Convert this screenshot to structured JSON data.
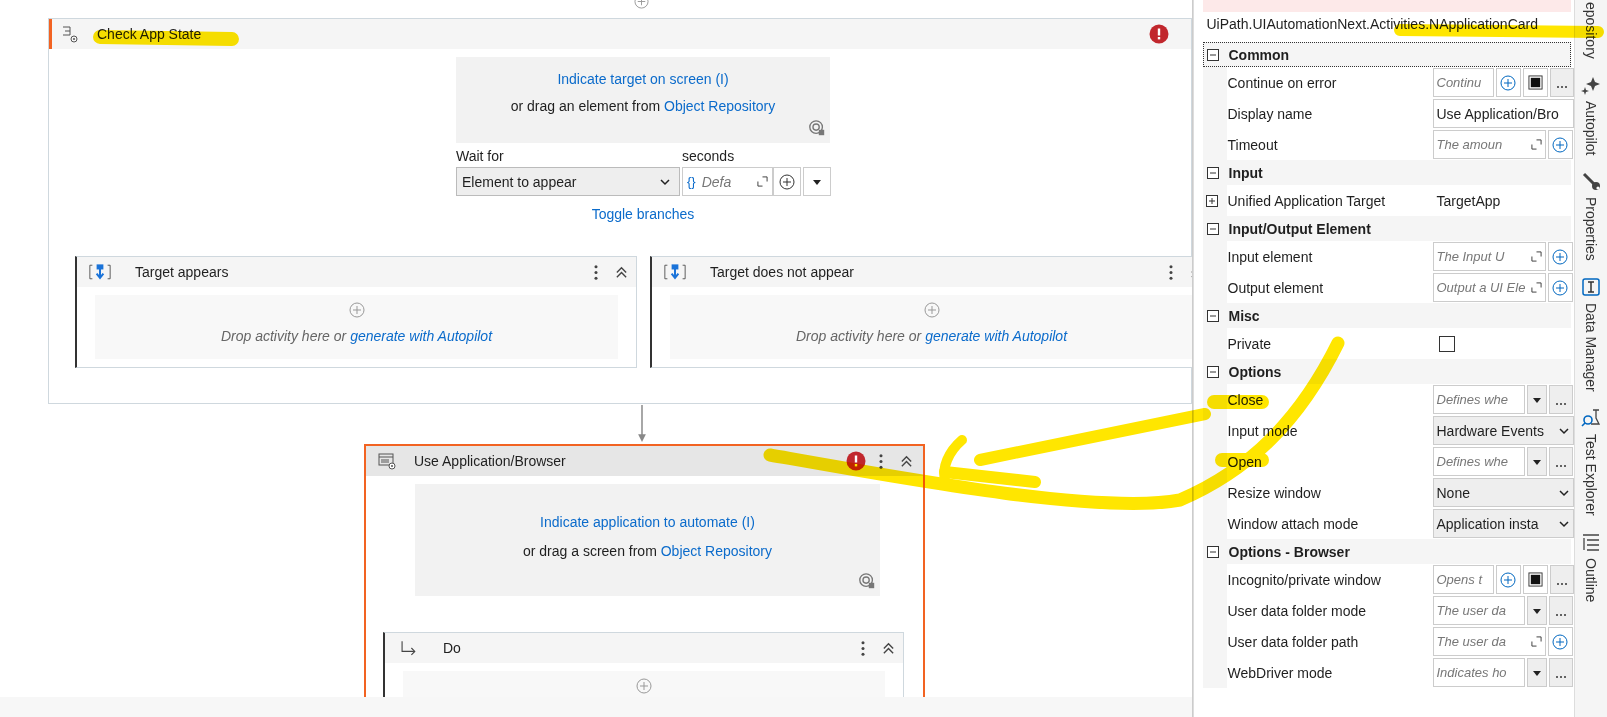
{
  "canvas": {
    "check_card": {
      "title": "Check App State",
      "error": true,
      "target": {
        "link": "Indicate target on screen (I)",
        "prefix": "or drag an element from",
        "repo_link": "Object Repository"
      },
      "wait_for": {
        "label": "Wait for",
        "value": "Element to appear"
      },
      "seconds": {
        "label": "seconds",
        "braces": "{}",
        "placeholder": "Defa"
      },
      "toggle": "Toggle branches",
      "branches": [
        {
          "title": "Target appears",
          "drop_text": "Drop activity here or",
          "drop_link": "generate with Autopilot"
        },
        {
          "title": "Target does not appear",
          "drop_text": "Drop activity here or",
          "drop_link": "generate with Autopilot"
        }
      ]
    },
    "app_card": {
      "title": "Use Application/Browser",
      "error": true,
      "selected": true,
      "target": {
        "link": "Indicate application to automate (I)",
        "prefix": "or drag a screen from",
        "repo_link": "Object Repository"
      },
      "do": {
        "title": "Do"
      }
    }
  },
  "properties": {
    "class_name": "UiPath.UIAutomationNext.Activities.NApplicationCard",
    "sections": [
      {
        "title": "Common",
        "expanded": true,
        "focused": true,
        "rows": [
          {
            "label": "Continue on error",
            "kind": "expr-bool",
            "placeholder": "Continu"
          },
          {
            "label": "Display name",
            "kind": "text",
            "value": "Use Application/Bro"
          },
          {
            "label": "Timeout",
            "kind": "expand",
            "placeholder": "The amoun"
          }
        ]
      },
      {
        "title": "Input",
        "expanded": true,
        "focused": false,
        "rows": [
          {
            "label": "Unified Application Target",
            "kind": "plain",
            "value": "TargetApp",
            "expanded": false
          }
        ]
      },
      {
        "title": "Input/Output Element",
        "expanded": true,
        "focused": false,
        "rows": [
          {
            "label": "Input element",
            "kind": "expand",
            "placeholder": "The Input U"
          },
          {
            "label": "Output element",
            "kind": "expand",
            "placeholder": "Output a UI Ele"
          }
        ]
      },
      {
        "title": "Misc",
        "expanded": true,
        "focused": false,
        "rows": [
          {
            "label": "Private",
            "kind": "checkbox",
            "checked": false
          }
        ]
      },
      {
        "title": "Options",
        "expanded": true,
        "focused": false,
        "rows": [
          {
            "label": "Close",
            "kind": "enum-expr",
            "placeholder": "Defines whe"
          },
          {
            "label": "Input mode",
            "kind": "select",
            "value": "Hardware Events"
          },
          {
            "label": "Open",
            "kind": "enum-expr",
            "placeholder": "Defines whe"
          },
          {
            "label": "Resize window",
            "kind": "select",
            "value": "None"
          },
          {
            "label": "Window attach mode",
            "kind": "select",
            "value": "Application insta"
          }
        ]
      },
      {
        "title": "Options - Browser",
        "expanded": true,
        "focused": false,
        "rows": [
          {
            "label": "Incognito/private window",
            "kind": "expr-bool",
            "placeholder": "Opens t"
          },
          {
            "label": "User data folder mode",
            "kind": "enum-expr",
            "placeholder": "The user da"
          },
          {
            "label": "User data folder path",
            "kind": "expand",
            "placeholder": "The user da"
          },
          {
            "label": "WebDriver mode",
            "kind": "enum-expr",
            "placeholder": "Indicates ho"
          }
        ]
      }
    ]
  },
  "side_tabs": [
    {
      "label": "epository"
    },
    {
      "label": "Autopilot"
    },
    {
      "label": "Properties"
    },
    {
      "label": "Data Manager"
    },
    {
      "label": "Test Explorer"
    },
    {
      "label": "Outline"
    }
  ]
}
